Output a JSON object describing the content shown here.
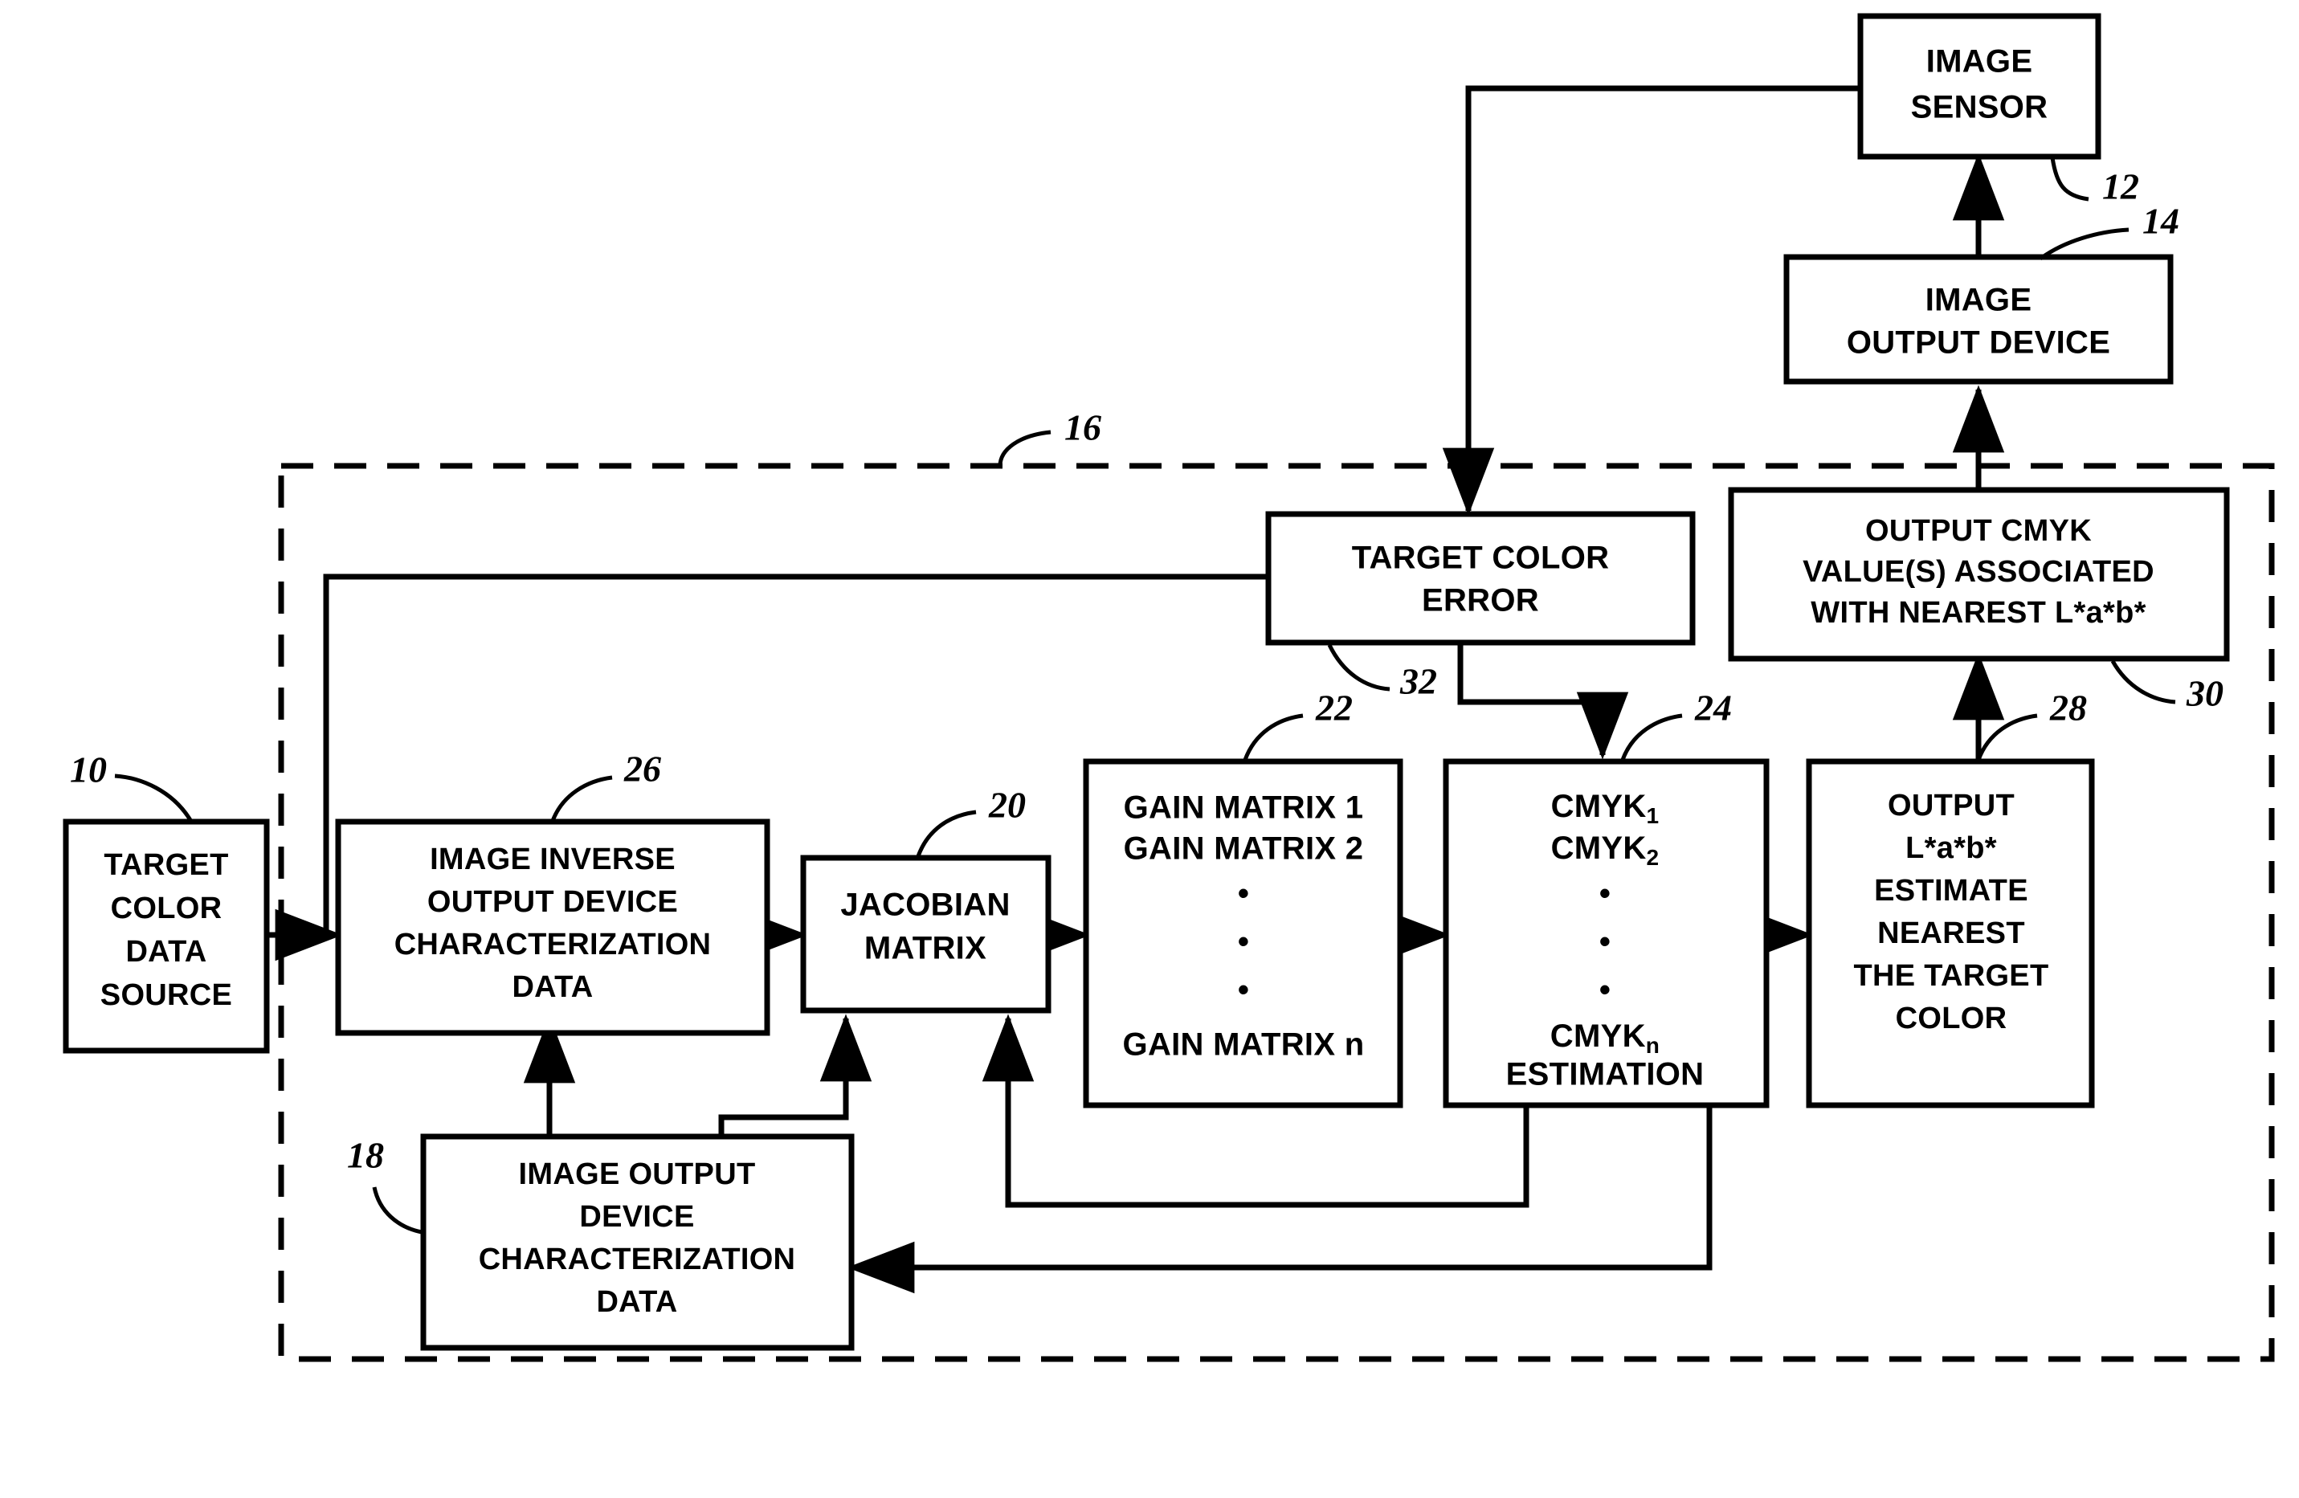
{
  "figure": {
    "type": "patent-block-diagram",
    "background_color": "#ffffff",
    "line_color": "#000000"
  },
  "boxes": {
    "image_sensor": {
      "ref": "12",
      "lines": [
        "IMAGE",
        "SENSOR"
      ]
    },
    "image_output_device": {
      "ref": "14",
      "lines": [
        "IMAGE",
        "OUTPUT DEVICE"
      ]
    },
    "target_color_error": {
      "ref": "32",
      "lines": [
        "TARGET COLOR",
        "ERROR"
      ]
    },
    "output_cmyk_values": {
      "ref": "30",
      "lines": [
        "OUTPUT CMYK",
        "VALUE(S) ASSOCIATED",
        "WITH NEAREST L*a*b*"
      ]
    },
    "target_color_data_source": {
      "ref": "10",
      "lines": [
        "TARGET",
        "COLOR",
        "DATA",
        "SOURCE"
      ]
    },
    "image_inverse_output_device_char_data": {
      "ref": "26",
      "lines": [
        "IMAGE INVERSE",
        "OUTPUT DEVICE",
        "CHARACTERIZATION",
        "DATA"
      ]
    },
    "jacobian_matrix": {
      "ref": "20",
      "lines": [
        "JACOBIAN",
        "MATRIX"
      ]
    },
    "gain_matrix": {
      "ref": "22",
      "lines": [
        "GAIN MATRIX 1",
        "GAIN MATRIX 2"
      ],
      "ellipsis": "•",
      "last_line": "GAIN MATRIX n"
    },
    "cmyk_estimation": {
      "ref": "24",
      "line1_base": "CMYK",
      "line1_sub": "1",
      "line2_base": "CMYK",
      "line2_sub": "2",
      "ellipsis": "•",
      "last_base": "CMYK",
      "last_sub": "n",
      "last_line": "ESTIMATION"
    },
    "output_lab_estimate": {
      "ref": "28",
      "lines": [
        "OUTPUT",
        "L*a*b*",
        "ESTIMATE",
        "NEAREST",
        "THE TARGET",
        "COLOR"
      ]
    },
    "image_output_device_char_data": {
      "ref": "18",
      "lines": [
        "IMAGE OUTPUT",
        "DEVICE",
        "CHARACTERIZATION",
        "DATA"
      ]
    }
  },
  "enclosure": {
    "ref": "16",
    "style": "dashed"
  }
}
